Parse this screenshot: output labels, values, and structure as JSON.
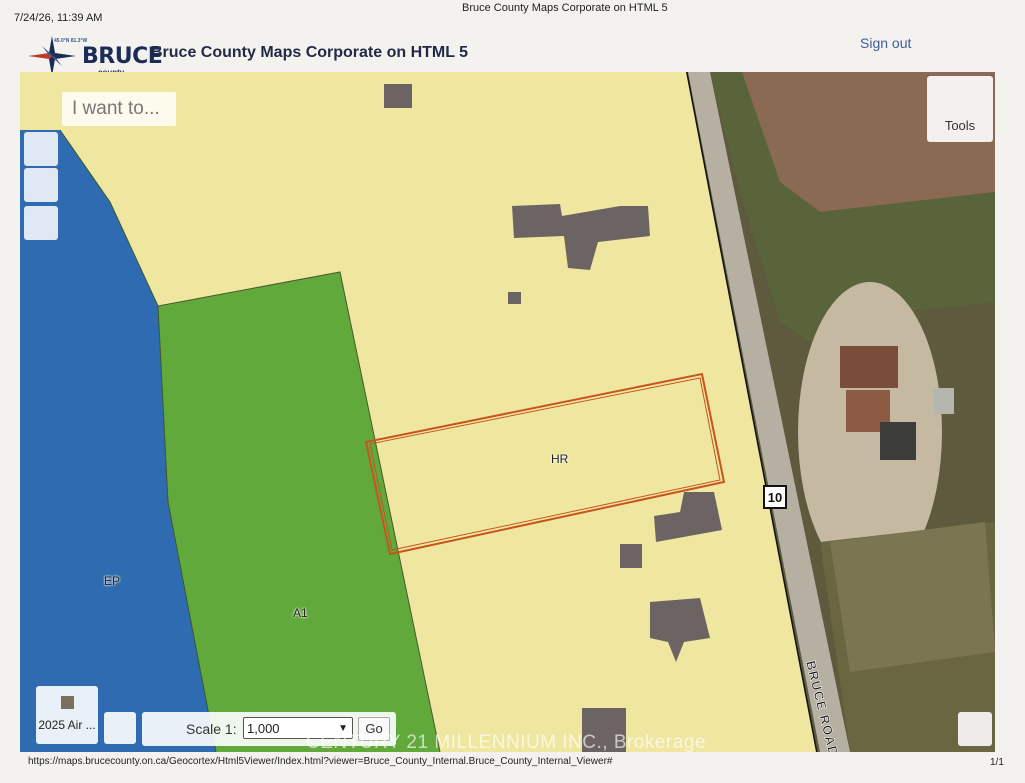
{
  "print_header": {
    "date": "7/24/26, 11:39 AM",
    "title": "Bruce County Maps Corporate on HTML 5"
  },
  "print_footer": {
    "url": "https://maps.brucecounty.on.ca/Geocortex/Html5Viewer/Index.html?viewer=Bruce_County_Internal.Bruce_County_Internal_Viewer#",
    "page": "1/1"
  },
  "header": {
    "logo_coords": "45.0°N 81.3°W",
    "logo_brand": "BRUCE",
    "logo_sub": "county",
    "app_title": "Bruce County Maps Corporate on HTML 5",
    "sign_out": "Sign out"
  },
  "map": {
    "i_want_to": "I want to...",
    "tools_label": "Tools",
    "basemap_label": "2025 Air ...",
    "scale_label": "Scale 1:",
    "scale_value": "1,000",
    "go_label": "Go",
    "watermark": "CENTURY 21 MILLENNIUM INC., Brokerage",
    "zones": {
      "ep": "EP",
      "a1": "A1",
      "hr": "HR"
    },
    "highway_shield": "10",
    "road_name": "BRUCE ROAD",
    "colors": {
      "zone_hr": "#efe7a0",
      "zone_a1": "#62a93c",
      "zone_ep": "#2f6bb0",
      "building": "#6b6462",
      "parcel_outline": "#c8541e"
    }
  }
}
